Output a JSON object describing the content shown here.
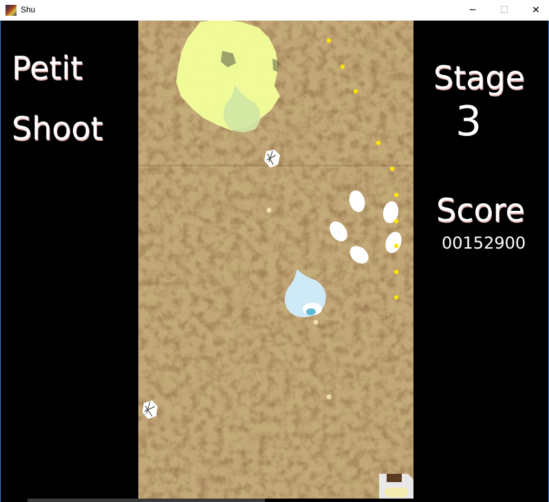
{
  "window": {
    "title": "Shu",
    "minimize_glyph": "─",
    "maximize_glyph": "☐",
    "close_glyph": "✕"
  },
  "left_panel": {
    "line1": "Petit",
    "line2": "Shoot"
  },
  "right_panel": {
    "stage_label": "Stage",
    "stage_value": "3",
    "score_label": "Score",
    "score_value": "00152900"
  },
  "colors": {
    "rust_dark": "#5a3418",
    "rust_mid": "#8a5a2a",
    "rust_light": "#c9a468",
    "player": "#cfeaf7",
    "boss_blob": "#f2ff9a",
    "enemy_bullet": "#ffe600",
    "enemy_white": "#ffffff",
    "small_bullet": "#f2dfb0"
  },
  "icons": {
    "save": "save-icon"
  }
}
